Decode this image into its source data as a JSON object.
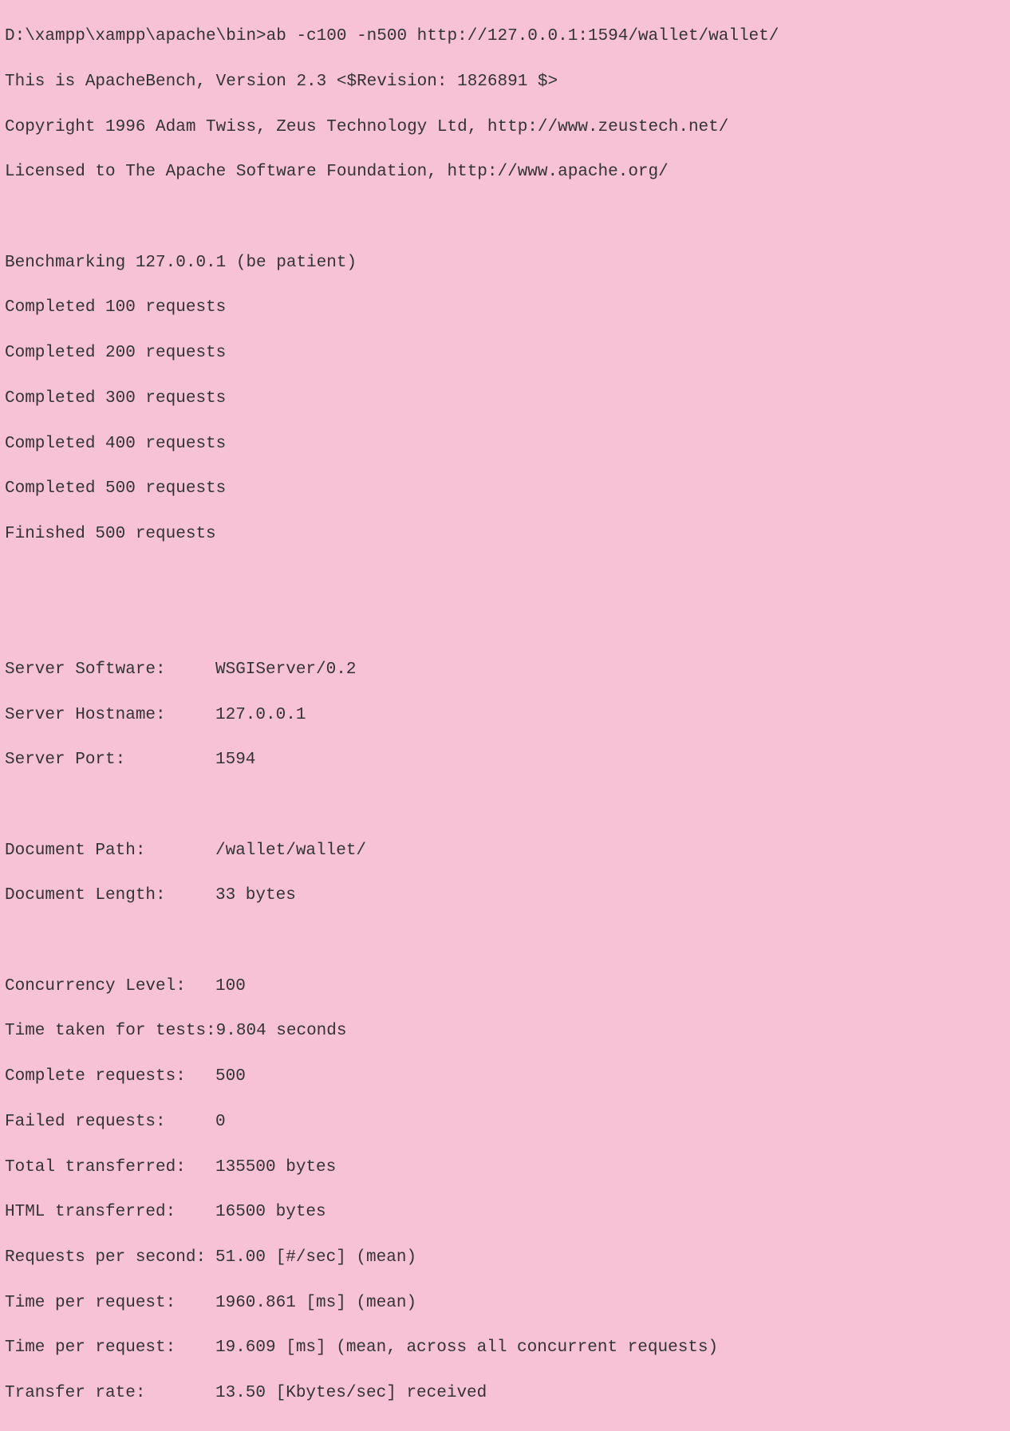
{
  "header": {
    "command": "D:\\xampp\\xampp\\apache\\bin>ab -c100 -n500 http://127.0.0.1:1594/wallet/wallet/",
    "intro": "This is ApacheBench, Version 2.3 <$Revision: 1826891 $>",
    "copyright": "Copyright 1996 Adam Twiss, Zeus Technology Ltd, http://www.zeustech.net/",
    "license": "Licensed to The Apache Software Foundation, http://www.apache.org/"
  },
  "benchmark": {
    "status": "Benchmarking 127.0.0.1 (be patient)",
    "progress": [
      "Completed 100 requests",
      "Completed 200 requests",
      "Completed 300 requests",
      "Completed 400 requests",
      "Completed 500 requests",
      "Finished 500 requests"
    ]
  },
  "results": {
    "server_software": {
      "label": "Server Software:",
      "value": "WSGIServer/0.2"
    },
    "server_hostname": {
      "label": "Server Hostname:",
      "value": "127.0.0.1"
    },
    "server_port": {
      "label": "Server Port:",
      "value": "1594"
    },
    "document_path": {
      "label": "Document Path:",
      "value": "/wallet/wallet/"
    },
    "document_length": {
      "label": "Document Length:",
      "value": "33 bytes"
    },
    "concurrency_level": {
      "label": "Concurrency Level:",
      "value": "100"
    },
    "time_taken": {
      "label": "Time taken for tests:",
      "value": "9.804 seconds"
    },
    "complete_requests": {
      "label": "Complete requests:",
      "value": "500"
    },
    "failed_requests": {
      "label": "Failed requests:",
      "value": "0"
    },
    "total_transferred": {
      "label": "Total transferred:",
      "value": "135500 bytes"
    },
    "html_transferred": {
      "label": "HTML transferred:",
      "value": "16500 bytes"
    },
    "requests_per_second": {
      "label": "Requests per second:",
      "value": "51.00 [#/sec] (mean)"
    },
    "time_per_request_1": {
      "label": "Time per request:",
      "value": "1960.861 [ms] (mean)"
    },
    "time_per_request_2": {
      "label": "Time per request:",
      "value": "19.609 [ms] (mean, across all concurrent requests)"
    },
    "transfer_rate": {
      "label": "Transfer rate:",
      "value": "13.50 [Kbytes/sec] received"
    }
  }
}
